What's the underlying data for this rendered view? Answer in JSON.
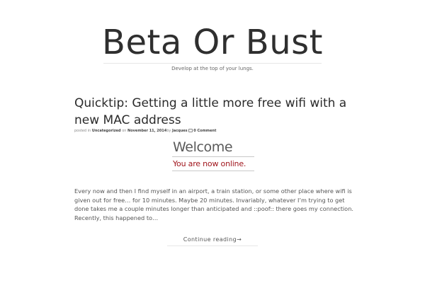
{
  "site": {
    "title": "Beta Or Bust",
    "tagline": "Develop at the top of your lungs."
  },
  "post": {
    "title": "Quicktip: Getting a little more free wifi with a new MAC address",
    "meta": {
      "posted_in_label": "posted in",
      "category": "Uncategorized",
      "on_label": "on",
      "date": "November 11, 2014",
      "by_label": "by",
      "author": "Jacques",
      "comments": "0 Comment",
      "comment_icon": "comment-icon"
    },
    "image": {
      "welcome": "Welcome",
      "online": "You are now online.",
      "online_color": "#a0151c"
    },
    "excerpt": "Every now and then I find myself in an airport, a train station, or some other place where wifi is given out for free… for 10 minutes. Maybe 20 minutes. Invariably, whatever I’m trying to get done takes me a couple minutes longer than anticipated and ::poof:: there goes my connection. Recently, this happened to…",
    "continue_label": "Continue reading",
    "continue_arrow": "→"
  }
}
